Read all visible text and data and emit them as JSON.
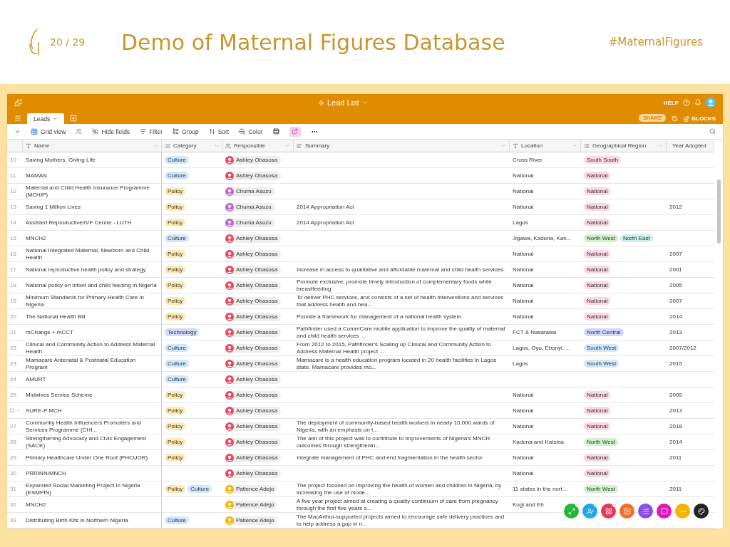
{
  "slide": {
    "page_counter": "20 / 29",
    "title": "Demo of Maternal Figures Database",
    "hashtag": "#MaternalFigures"
  },
  "app": {
    "base_title": "Lead List",
    "help_label": "HELP",
    "share_label": "SHARE",
    "blocks_label": "BLOCKS",
    "tabs": [
      {
        "label": "Leads",
        "selected": true
      }
    ],
    "view_label": "Grid view",
    "tools": [
      {
        "kind": "hide",
        "label": "Hide fields"
      },
      {
        "kind": "filter",
        "label": "Filter"
      },
      {
        "kind": "group",
        "label": "Group"
      },
      {
        "kind": "sort",
        "label": "Sort"
      },
      {
        "kind": "color",
        "label": "Color"
      }
    ],
    "columns": [
      {
        "kind": "text",
        "label": "Name"
      },
      {
        "kind": "select",
        "label": "Category"
      },
      {
        "kind": "people",
        "label": "Responsible"
      },
      {
        "kind": "longtext",
        "label": "Summary"
      },
      {
        "kind": "text",
        "label": "Location"
      },
      {
        "kind": "select",
        "label": "Geographical Region"
      },
      {
        "kind": "text",
        "label": "Year Adopted"
      }
    ],
    "rows": [
      {
        "hovered": false,
        "number": "10",
        "name": "Saving Mothers, Giving Life",
        "categories": [
          {
            "label": "Culture",
            "color": "#d0e8fc"
          }
        ],
        "responsible": {
          "name": "Ashley Obasosa",
          "color": "#e8475f"
        },
        "summary": "",
        "location": "Cross River",
        "regions": [
          {
            "label": "South South",
            "color": "#fcd6e3"
          }
        ],
        "year": ""
      },
      {
        "hovered": false,
        "number": "11",
        "name": "MAMAN",
        "categories": [
          {
            "label": "Culture",
            "color": "#d0e8fc"
          }
        ],
        "responsible": {
          "name": "Ashley Obasosa",
          "color": "#e8475f"
        },
        "summary": "",
        "location": "National",
        "regions": [
          {
            "label": "National",
            "color": "#fcd6e3"
          }
        ],
        "year": ""
      },
      {
        "hovered": false,
        "number": "12",
        "name": "Maternal and Child Health Insurance Programme (MCHIP)",
        "categories": [
          {
            "label": "Policy",
            "color": "#fdeab2"
          }
        ],
        "responsible": {
          "name": "Chuma Asuzu",
          "color": "#c260d8"
        },
        "summary": "",
        "location": "National",
        "regions": [
          {
            "label": "National",
            "color": "#fcd6e3"
          }
        ],
        "year": ""
      },
      {
        "hovered": false,
        "number": "13",
        "name": "Saving 1 Million Lives",
        "categories": [
          {
            "label": "Policy",
            "color": "#fdeab2"
          }
        ],
        "responsible": {
          "name": "Chuma Asuzu",
          "color": "#c260d8"
        },
        "summary": "2014 Appropriation Act",
        "location": "National",
        "regions": [
          {
            "label": "National",
            "color": "#fcd6e3"
          }
        ],
        "year": "2012"
      },
      {
        "hovered": false,
        "number": "14",
        "name": "Assisted Reproductive/IVF Centre - LUTH",
        "categories": [
          {
            "label": "Policy",
            "color": "#fdeab2"
          }
        ],
        "responsible": {
          "name": "Chuma Asuzu",
          "color": "#c260d8"
        },
        "summary": "2014 Appropriation Act",
        "location": "Lagos",
        "regions": [
          {
            "label": "National",
            "color": "#fcd6e3"
          }
        ],
        "year": ""
      },
      {
        "hovered": false,
        "number": "15",
        "name": "MNCH2",
        "categories": [
          {
            "label": "Culture",
            "color": "#d0e8fc"
          }
        ],
        "responsible": {
          "name": "Ashley Obasosa",
          "color": "#e8475f"
        },
        "summary": "",
        "location": "Jigawa, Kaduna, Kan...",
        "regions": [
          {
            "label": "North West",
            "color": "#d2f2cc"
          },
          {
            "label": "North East",
            "color": "#c9f0ec"
          }
        ],
        "year": ""
      },
      {
        "hovered": false,
        "number": "16",
        "name": "National Integrated Maternal, Newborn and Child Health",
        "categories": [
          {
            "label": "Policy",
            "color": "#fdeab2"
          }
        ],
        "responsible": {
          "name": "Ashley Obasosa",
          "color": "#e8475f"
        },
        "summary": "",
        "location": "National",
        "regions": [
          {
            "label": "National",
            "color": "#fcd6e3"
          }
        ],
        "year": "2007"
      },
      {
        "hovered": false,
        "number": "17",
        "name": "National reproductive health policy and strategy",
        "categories": [
          {
            "label": "Policy",
            "color": "#fdeab2"
          }
        ],
        "responsible": {
          "name": "Ashley Obasosa",
          "color": "#e8475f"
        },
        "summary": "Increase in access to qualitative and affordable maternal and child health services.",
        "location": "National",
        "regions": [
          {
            "label": "National",
            "color": "#fcd6e3"
          }
        ],
        "year": "2001"
      },
      {
        "hovered": false,
        "number": "18",
        "name": "National policy on infant and child feeding in Nigeria",
        "categories": [
          {
            "label": "Policy",
            "color": "#fdeab2"
          }
        ],
        "responsible": {
          "name": "Ashley Obasosa",
          "color": "#e8475f"
        },
        "summary": "Promote exclusive; promote timely introduction of complementary foods while breastfeeding.",
        "location": "National",
        "regions": [
          {
            "label": "National",
            "color": "#fcd6e3"
          }
        ],
        "year": "2005"
      },
      {
        "hovered": false,
        "number": "19",
        "name": "Minimum Standards for Primary Health Care in Nigeria",
        "categories": [
          {
            "label": "Policy",
            "color": "#fdeab2"
          }
        ],
        "responsible": {
          "name": "Ashley Obasosa",
          "color": "#e8475f"
        },
        "summary": "To deliver PHC services, and consists of a set of health interventions and services that address health and hea...",
        "location": "National",
        "regions": [
          {
            "label": "National",
            "color": "#fcd6e3"
          }
        ],
        "year": "2007"
      },
      {
        "hovered": false,
        "number": "20",
        "name": "The National Health Bill",
        "categories": [
          {
            "label": "Policy",
            "color": "#fdeab2"
          }
        ],
        "responsible": {
          "name": "Ashley Obasosa",
          "color": "#e8475f"
        },
        "summary": "Provide a framework for management of a national health system.",
        "location": "National",
        "regions": [
          {
            "label": "National",
            "color": "#fcd6e3"
          }
        ],
        "year": "2014"
      },
      {
        "hovered": false,
        "number": "21",
        "name": "mChange + mCCT",
        "categories": [
          {
            "label": "Technology",
            "color": "#d3d9f8"
          }
        ],
        "responsible": {
          "name": "Ashley Obasosa",
          "color": "#e8475f"
        },
        "summary": "Pathfinder used a CommCare mobile application to improve the quality of maternal and child health services ...",
        "location": "FCT & Nasarawa",
        "regions": [
          {
            "label": "North Central",
            "color": "#cfd9fb"
          }
        ],
        "year": "2013"
      },
      {
        "hovered": false,
        "number": "22",
        "name": "Clinical and Community Action to Address Maternal Health",
        "categories": [
          {
            "label": "Culture",
            "color": "#d0e8fc"
          }
        ],
        "responsible": {
          "name": "Ashley Obasosa",
          "color": "#e8475f"
        },
        "summary": "From 2012 to 2015, Pathfinder's Scaling up Clinical and Community Action to Address Maternal Health project ...",
        "location": "Lagos, Oyo, Ebonyi, ...",
        "regions": [
          {
            "label": "South West",
            "color": "#d0e8fc"
          }
        ],
        "year": "2007/2012"
      },
      {
        "hovered": false,
        "number": "23",
        "name": "Mamacare Antenatal & Postnatal Education Program",
        "categories": [
          {
            "label": "Culture",
            "color": "#d0e8fc"
          }
        ],
        "responsible": {
          "name": "Ashley Obasosa",
          "color": "#e8475f"
        },
        "summary": "Mamacare is a health education program located in 20 health facilities in Lagos state. Mamacare provides mo...",
        "location": "Lagos",
        "regions": [
          {
            "label": "South West",
            "color": "#d0e8fc"
          }
        ],
        "year": "2015"
      },
      {
        "hovered": false,
        "number": "24",
        "name": "AMURT",
        "categories": [
          {
            "label": "Culture",
            "color": "#d0e8fc"
          }
        ],
        "responsible": {
          "name": "Ashley Obasosa",
          "color": "#e8475f"
        },
        "summary": "",
        "location": "",
        "regions": [],
        "year": ""
      },
      {
        "hovered": false,
        "number": "25",
        "name": "Midwives Service Scheme",
        "categories": [
          {
            "label": "Policy",
            "color": "#fdeab2"
          }
        ],
        "responsible": {
          "name": "Ashley Obasosa",
          "color": "#e8475f"
        },
        "summary": "",
        "location": "National",
        "regions": [
          {
            "label": "National",
            "color": "#fcd6e3"
          }
        ],
        "year": "2009"
      },
      {
        "hovered": true,
        "name": "SURE-P MCH",
        "categories": [
          {
            "label": "Policy",
            "color": "#fdeab2"
          }
        ],
        "responsible": {
          "name": "Ashley Obasosa",
          "color": "#e8475f"
        },
        "summary": "",
        "location": "National",
        "regions": [
          {
            "label": "National",
            "color": "#fcd6e3"
          }
        ],
        "year": "2013"
      },
      {
        "hovered": false,
        "number": "27",
        "name": "Community Health Influencers Promoters and Services Programme (CHI...",
        "categories": [
          {
            "label": "Policy",
            "color": "#fdeab2"
          }
        ],
        "responsible": {
          "name": "Ashley Obasosa",
          "color": "#e8475f"
        },
        "summary": "The deployment of community-based health workers in nearly 10,000 wards of Nigeria, with an emphasis on t...",
        "location": "National",
        "regions": [
          {
            "label": "National",
            "color": "#fcd6e3"
          }
        ],
        "year": "2018"
      },
      {
        "hovered": false,
        "number": "28",
        "name": "Strengthening Advocacy and Civic Engagement (SACE)",
        "categories": [
          {
            "label": "Policy",
            "color": "#fdeab2"
          }
        ],
        "responsible": {
          "name": "Ashley Obasosa",
          "color": "#e8475f"
        },
        "summary": "The aim of this project was to contribute to improvements of Nigeria's MNCH outcomes through strengthenin...",
        "location": "Kaduna and Katsina",
        "regions": [
          {
            "label": "North West",
            "color": "#d2f2cc"
          }
        ],
        "year": "2014"
      },
      {
        "hovered": false,
        "number": "29",
        "name": "Primary Healthcare Under One Roof (PHCUOR)",
        "categories": [
          {
            "label": "Policy",
            "color": "#fdeab2"
          }
        ],
        "responsible": {
          "name": "Ashley Obasosa",
          "color": "#e8475f"
        },
        "summary": "Integrate management of PHC and end fragmentation in the health sector",
        "location": "National",
        "regions": [
          {
            "label": "National",
            "color": "#fcd6e3"
          }
        ],
        "year": "2011"
      },
      {
        "hovered": false,
        "number": "30",
        "name": "PRRINN/MNCH",
        "categories": [],
        "responsible": {
          "name": "Ashley Obasosa",
          "color": "#e8475f"
        },
        "summary": "",
        "location": "National",
        "regions": [
          {
            "label": "National",
            "color": "#fcd6e3"
          }
        ],
        "year": ""
      },
      {
        "hovered": false,
        "number": "31",
        "name": "Expanded Social Marketing Project in Nigeria (ESMPIN)",
        "categories": [
          {
            "label": "Policy",
            "color": "#fdeab2"
          },
          {
            "label": "Culture",
            "color": "#d0e8fc"
          }
        ],
        "responsible": {
          "name": "Patience Adejo",
          "color": "#f5b400"
        },
        "summary": "The project focused on improving the health of women and children in Nigeria, by increasing the use of mode...",
        "location": "11 states in the nort...",
        "regions": [
          {
            "label": "North West",
            "color": "#d2f2cc"
          }
        ],
        "year": "2011"
      },
      {
        "hovered": false,
        "number": "32",
        "name": "MNCH2",
        "categories": [],
        "responsible": {
          "name": "Patience Adejo",
          "color": "#f5b400"
        },
        "summary": "A five year project aimed at creating a quality continuum of care from pregnancy through the first five years o...",
        "location": "Kogi and Eb",
        "regions": [],
        "year": ""
      },
      {
        "hovered": false,
        "number": "33",
        "name": "Distributing Birth Kits in Northern Nigeria",
        "categories": [
          {
            "label": "Culture",
            "color": "#d0e8fc"
          }
        ],
        "responsible": {
          "name": "Patience Adejo",
          "color": "#f5b400"
        },
        "summary": "The MacArthur-supported projects aimed to encourage safe delivery practices and to help address a gap in n...",
        "location": "",
        "regions": [],
        "year": ""
      }
    ],
    "action_buttons": [
      {
        "kind": "expand",
        "color": "#22b83a"
      },
      {
        "kind": "user",
        "color": "#1fa8e8"
      },
      {
        "kind": "apps",
        "color": "#e8385a"
      },
      {
        "kind": "image",
        "color": "#f0702a"
      },
      {
        "kind": "list",
        "color": "#8b4fe8"
      },
      {
        "kind": "chat",
        "color": "#e01ab8"
      },
      {
        "kind": "more",
        "color": "#f5b400"
      },
      {
        "kind": "palette",
        "color": "#222222"
      }
    ]
  }
}
